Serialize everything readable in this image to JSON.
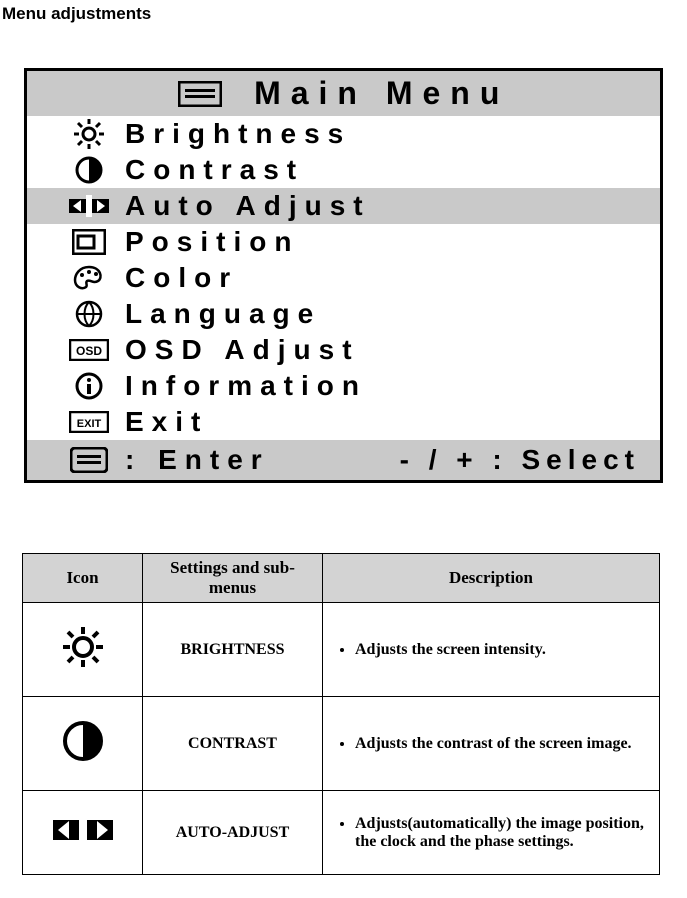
{
  "page": {
    "title": "Menu adjustments"
  },
  "osd": {
    "title": "Main Menu",
    "items": [
      {
        "label": "Brightness"
      },
      {
        "label": "Contrast"
      },
      {
        "label": "Auto Adjust"
      },
      {
        "label": "Position"
      },
      {
        "label": "Color"
      },
      {
        "label": "Language"
      },
      {
        "label": "OSD Adjust"
      },
      {
        "label": "Information"
      },
      {
        "label": "Exit"
      }
    ],
    "footer_enter": ": Enter",
    "footer_select": "- / + : Select"
  },
  "table": {
    "headers": {
      "icon": "Icon",
      "settings": "Settings and sub-menus",
      "description": "Description"
    },
    "rows": [
      {
        "setting": "BRIGHTNESS",
        "description": "Adjusts the screen intensity."
      },
      {
        "setting": "CONTRAST",
        "description": "Adjusts the contrast of the screen image."
      },
      {
        "setting": "AUTO-ADJUST",
        "description": "Adjusts(automatically) the image position, the clock and the phase settings."
      }
    ]
  }
}
